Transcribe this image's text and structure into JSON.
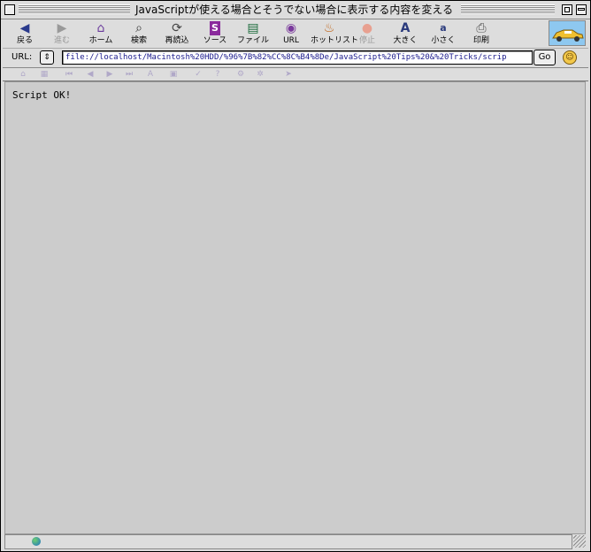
{
  "window": {
    "title": "JavaScriptが使える場合とそうでない場合に表示する内容を変える"
  },
  "toolbar": {
    "items": [
      {
        "label": "戻る",
        "icon": "back-arrow-icon",
        "glyph": "◀"
      },
      {
        "label": "進む",
        "icon": "forward-arrow-icon",
        "glyph": "▶"
      },
      {
        "label": "ホーム",
        "icon": "home-icon",
        "glyph": "⌂"
      },
      {
        "label": "検索",
        "icon": "search-icon",
        "glyph": "🔍"
      },
      {
        "label": "再読込",
        "icon": "reload-icon",
        "glyph": "⟳"
      },
      {
        "label": "ソース",
        "icon": "source-icon",
        "glyph": "S"
      },
      {
        "label": "ファイル",
        "icon": "file-icon",
        "glyph": "▤"
      },
      {
        "label": "URL",
        "icon": "url-globe-icon",
        "glyph": "◉"
      },
      {
        "label": "ホットリスト",
        "icon": "hotlist-icon",
        "glyph": "♨"
      },
      {
        "label": "停止",
        "icon": "stop-icon",
        "glyph": "●"
      },
      {
        "label": "大きく",
        "icon": "font-larger-icon",
        "glyph": "A"
      },
      {
        "label": "小さく",
        "icon": "font-smaller-icon",
        "glyph": "a"
      },
      {
        "label": "印刷",
        "icon": "print-icon",
        "glyph": "⎙"
      }
    ]
  },
  "urlbar": {
    "label": "URL:",
    "value": "file://localhost/Macintosh%20HDD/%96%7B%82%CC%8C%B4%8De/JavaScript%20Tips%20&%20Tricks/scrip",
    "go_label": "Go"
  },
  "favorites": {
    "icons": [
      "fav-home-icon",
      "fav-grid-icon",
      "fav-rewind-icon",
      "fav-back-icon",
      "fav-forward-icon",
      "fav-fastforward-icon",
      "fav-font-icon",
      "fav-image-icon",
      "fav-check-icon",
      "fav-help-icon",
      "fav-gear-icon",
      "fav-settings-icon",
      "fav-bookmark-icon"
    ]
  },
  "content": {
    "text": "Script OK!"
  },
  "colors": {
    "chrome": "#dddddd",
    "content_bg": "#cccccc",
    "url_text": "#1a1a8c"
  }
}
